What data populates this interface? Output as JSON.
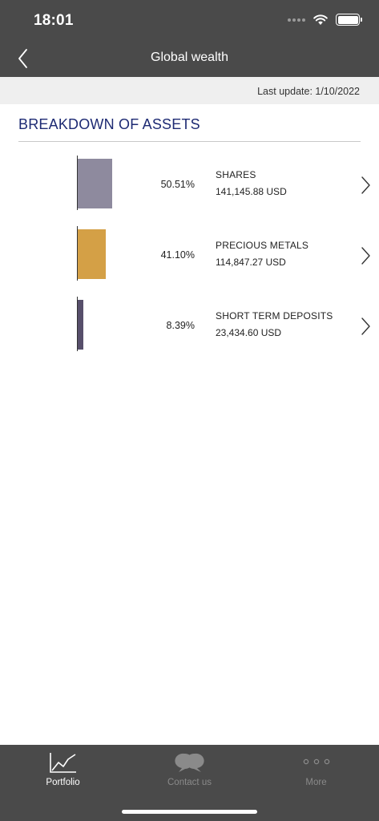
{
  "status": {
    "time": "18:01"
  },
  "header": {
    "title": "Global wealth"
  },
  "update": {
    "text": "Last update: 1/10/2022"
  },
  "section": {
    "title": "BREAKDOWN OF ASSETS"
  },
  "assets": [
    {
      "name": "SHARES",
      "percent": "50.51%",
      "amount": "141,145.88 USD",
      "share": 50.51,
      "color": "#8e8a9e"
    },
    {
      "name": "PRECIOUS METALS",
      "percent": "41.10%",
      "amount": "114,847.27 USD",
      "share": 41.1,
      "color": "#d4a046"
    },
    {
      "name": "SHORT TERM DEPOSITS",
      "percent": "8.39%",
      "amount": "23,434.60 USD",
      "share": 8.39,
      "color": "#574f6b"
    }
  ],
  "tabs": [
    {
      "label": "Portfolio",
      "icon": "line-chart-icon",
      "active": true
    },
    {
      "label": "Contact us",
      "icon": "chat-bubbles-icon",
      "active": false
    },
    {
      "label": "More",
      "icon": "more-dots-icon",
      "active": false
    }
  ],
  "colors": {
    "bar_bg": "#4a4a4a",
    "title_blue": "#1d2a73",
    "strip_bg": "#efefef",
    "tab_active": "#ffffff",
    "tab_inactive": "#8a8a8a"
  }
}
